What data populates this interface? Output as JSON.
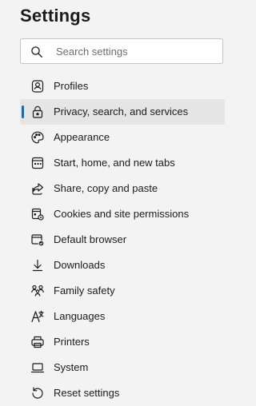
{
  "header": {
    "title": "Settings"
  },
  "search": {
    "placeholder": "Search settings",
    "value": "",
    "icon": "search-icon"
  },
  "accent_color": "#0f6cbd",
  "sidebar": {
    "selected": "Privacy, search, and services",
    "items": [
      {
        "label": "Profiles",
        "icon": "profile-icon"
      },
      {
        "label": "Privacy, search, and services",
        "icon": "lock-icon"
      },
      {
        "label": "Appearance",
        "icon": "palette-icon"
      },
      {
        "label": "Start, home, and new tabs",
        "icon": "home-tabs-icon"
      },
      {
        "label": "Share, copy and paste",
        "icon": "share-icon"
      },
      {
        "label": "Cookies and site permissions",
        "icon": "cookies-permissions-icon"
      },
      {
        "label": "Default browser",
        "icon": "default-browser-icon"
      },
      {
        "label": "Downloads",
        "icon": "download-icon"
      },
      {
        "label": "Family safety",
        "icon": "family-icon"
      },
      {
        "label": "Languages",
        "icon": "language-icon"
      },
      {
        "label": "Printers",
        "icon": "printer-icon"
      },
      {
        "label": "System",
        "icon": "laptop-icon"
      },
      {
        "label": "Reset settings",
        "icon": "reset-icon"
      }
    ]
  }
}
